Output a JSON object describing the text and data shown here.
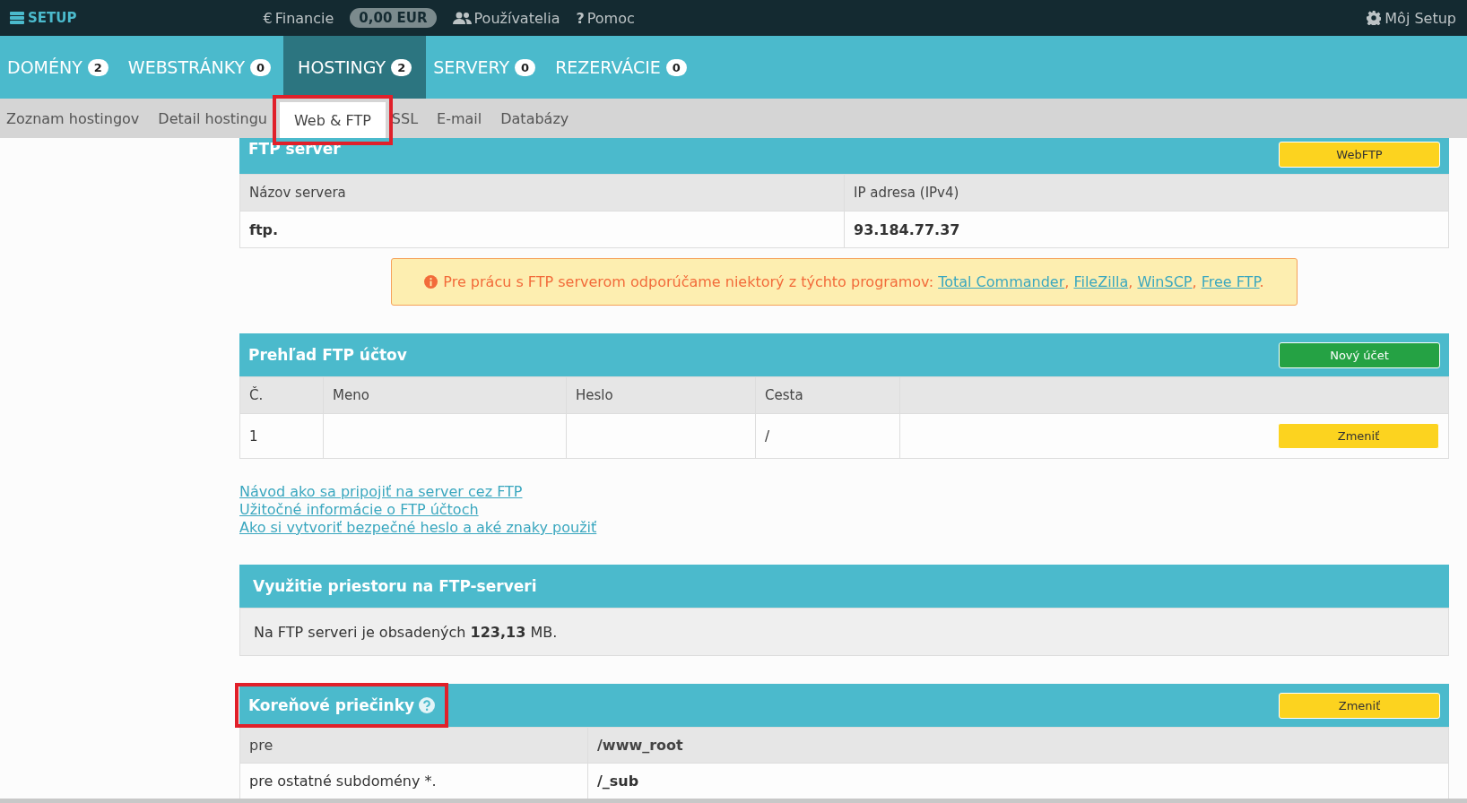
{
  "topbar": {
    "logo": "SETUP",
    "finance": {
      "symbol": "€",
      "label": "Financie"
    },
    "balance": "0,00 EUR",
    "users": {
      "label": "Používatelia"
    },
    "help": {
      "symbol": "?",
      "label": "Pomoc"
    },
    "account": {
      "label": "Môj Setup"
    }
  },
  "tabs": [
    {
      "label": "DOMÉNY",
      "count": "2",
      "selected": false
    },
    {
      "label": "WEBSTRÁNKY",
      "count": "0",
      "selected": false
    },
    {
      "label": "HOSTINGY",
      "count": "2",
      "selected": true
    },
    {
      "label": "SERVERY",
      "count": "0",
      "selected": false
    },
    {
      "label": "REZERVÁCIE",
      "count": "0",
      "selected": false
    }
  ],
  "subtabs": [
    {
      "label": "Zoznam hostingov",
      "selected": false,
      "highlighted": false
    },
    {
      "label": "Detail hostingu",
      "selected": false,
      "highlighted": false
    },
    {
      "label": "Web & FTP",
      "selected": true,
      "highlighted": true
    },
    {
      "label": "SSL",
      "selected": false,
      "highlighted": false
    },
    {
      "label": "E-mail",
      "selected": false,
      "highlighted": false
    },
    {
      "label": "Databázy",
      "selected": false,
      "highlighted": false
    }
  ],
  "ftp_server": {
    "title": "FTP server",
    "button": "WebFTP",
    "columns": [
      "Názov servera",
      "IP adresa (IPv4)"
    ],
    "values": [
      "ftp.",
      "93.184.77.37"
    ]
  },
  "alert": {
    "parts": [
      {
        "kind": "text",
        "text": "Pre prácu s FTP serverom odporúčame niektorý z týchto programov: "
      },
      {
        "kind": "link",
        "text": "Total Commander"
      },
      {
        "kind": "text",
        "text": ", "
      },
      {
        "kind": "link",
        "text": "FileZilla"
      },
      {
        "kind": "text",
        "text": ", "
      },
      {
        "kind": "link",
        "text": "WinSCP"
      },
      {
        "kind": "text",
        "text": ", "
      },
      {
        "kind": "link",
        "text": "Free FTP"
      },
      {
        "kind": "text",
        "text": "."
      }
    ]
  },
  "accounts": {
    "title": "Prehľad FTP účtov",
    "button": "Nový účet",
    "columns": [
      "Č.",
      "Meno",
      "Heslo",
      "Cesta"
    ],
    "rows": [
      {
        "number": "1",
        "path": "/",
        "button": "Zmeniť"
      }
    ]
  },
  "help_links": [
    "Návod ako sa pripojiť na server cez FTP",
    "Užitočné informácie o FTP účtoch",
    "Ako si vytvoriť bezpečné heslo a aké znaky použiť"
  ],
  "usage": {
    "title": "Využitie priestoru na FTP-serveri",
    "text": "Na FTP serveri je obsadených **123,13** MB."
  },
  "root_folders": {
    "title": "Koreňové priečinky",
    "highlighted": true,
    "button": "Zmeniť",
    "rows": [
      {
        "label": "pre",
        "value": "/www_root"
      },
      {
        "label": "pre ostatné subdomény *.",
        "value": "/_sub"
      }
    ]
  }
}
